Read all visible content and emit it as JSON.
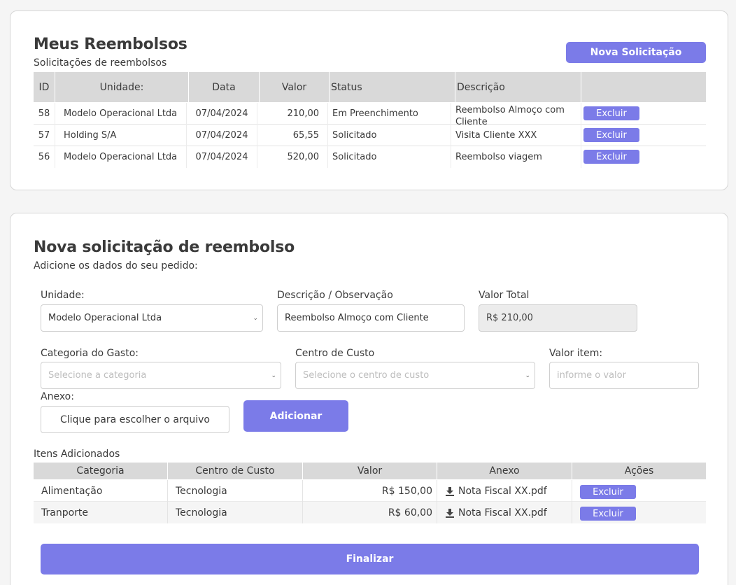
{
  "reimbursements": {
    "title": "Meus Reembolsos",
    "subtitle": "Solicitações de reembolsos",
    "new_button": "Nova Solicitação",
    "columns": [
      "ID",
      "Unidade:",
      "Data",
      "Valor",
      "Status",
      "Descrição",
      ""
    ],
    "rows": [
      {
        "id": "58",
        "unit": "Modelo Operacional Ltda",
        "date": "07/04/2024",
        "value": "210,00",
        "status": "Em Preenchimento",
        "description": "Reembolso Almoço com Cliente",
        "action": "Excluir"
      },
      {
        "id": "57",
        "unit": "Holding S/A",
        "date": "07/04/2024",
        "value": "65,55",
        "status": "Solicitado",
        "description": "Visita Cliente XXX",
        "action": "Excluir"
      },
      {
        "id": "56",
        "unit": "Modelo Operacional Ltda",
        "date": "07/04/2024",
        "value": "520,00",
        "status": "Solicitado",
        "description": "Reembolso viagem",
        "action": "Excluir"
      }
    ]
  },
  "form": {
    "title": "Nova solicitação de reembolso",
    "subtitle": "Adicione os dados do seu pedido:",
    "unit_label": "Unidade:",
    "unit_value": "Modelo Operacional Ltda",
    "desc_label": "Descrição / Observação",
    "desc_value": "Reembolso Almoço com Cliente",
    "total_label": "Valor Total",
    "total_value": "R$ 210,00",
    "category_label": "Categoria do Gasto:",
    "category_placeholder": "Selecione a categoria",
    "cost_center_label": "Centro de Custo",
    "cost_center_placeholder": "Selecione o centro de custo",
    "item_value_label": "Valor item:",
    "item_value_placeholder": "informe o valor",
    "attachment_label": "Anexo:",
    "attachment_button": "Clique para escolher o arquivo",
    "add_button": "Adicionar",
    "items_title": "Itens Adicionados",
    "items_columns": [
      "Categoria",
      "Centro de Custo",
      "Valor",
      "Anexo",
      "Ações"
    ],
    "items": [
      {
        "category": "Alimentação",
        "cost_center": "Tecnologia",
        "value": "R$ 150,00",
        "attachment": "Nota Fiscal XX.pdf",
        "action": "Excluir"
      },
      {
        "category": "Tranporte",
        "cost_center": "Tecnologia",
        "value": "R$ 60,00",
        "attachment": "Nota Fiscal XX.pdf",
        "action": "Excluir"
      }
    ],
    "finish_button": "Finalizar"
  },
  "colors": {
    "accent": "#7b7be8",
    "header_bg": "#d9d9d9"
  },
  "icons": {
    "download": "download-icon",
    "chevron": "chevron-down-icon"
  }
}
